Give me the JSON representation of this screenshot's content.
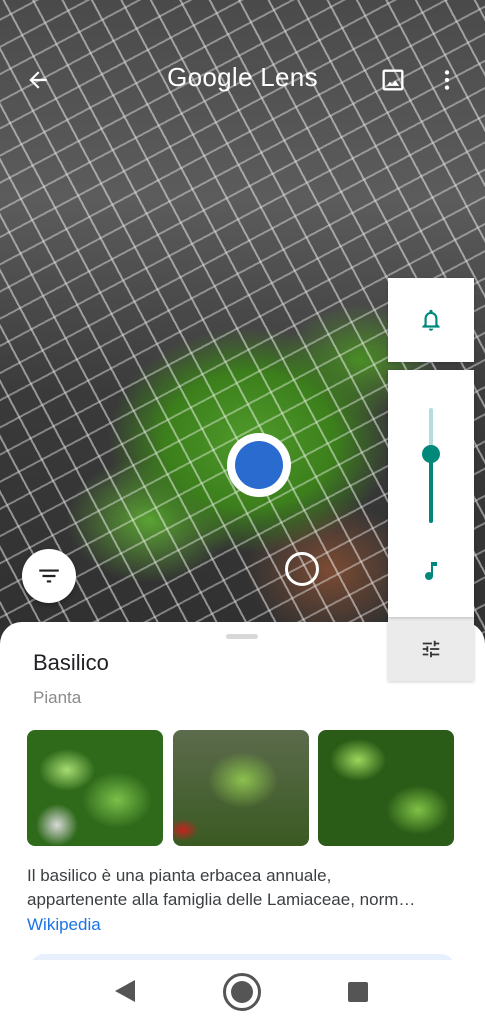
{
  "header": {
    "title": "Google Lens",
    "back_icon": "arrow-left-icon",
    "gallery_icon": "image-icon",
    "menu_icon": "more-vert-icon"
  },
  "result": {
    "title": "Basilico",
    "category": "Pianta",
    "description_line1": "Il basilico è una pianta erbacea annuale,",
    "description_line2": "appartenente alla famiglia delle Lamiaceae, norm…",
    "source_link": "Wikipedia"
  },
  "volume_panel": {
    "level": 0.6,
    "accent_color": "#00897b",
    "track_color": "#b2dfdb",
    "icons": [
      "bell-icon",
      "music-note-icon",
      "tune-icon"
    ]
  },
  "colors": {
    "selection_dot": "#2a6bd0",
    "link": "#1a73e8"
  },
  "nav": {
    "icons": [
      "nav-back-icon",
      "nav-home-icon",
      "nav-recents-icon"
    ]
  }
}
